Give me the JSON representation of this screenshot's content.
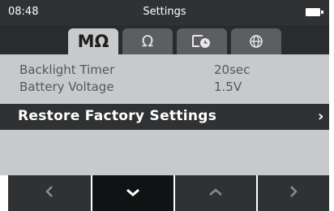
{
  "status": {
    "time": "08:48",
    "title": "Settings",
    "battery": "battery-icon"
  },
  "tabs": [
    {
      "label": "MΩ",
      "active": true
    },
    {
      "label": "Ω",
      "active": false
    },
    {
      "icon": "timer-icon",
      "active": false
    },
    {
      "icon": "globe-icon",
      "active": false
    }
  ],
  "settings": [
    {
      "label": "Backlight Timer",
      "value": "20sec"
    },
    {
      "label": "Battery Voltage",
      "value": "1.5V"
    }
  ],
  "highlighted": {
    "label": "Restore Factory Settings"
  },
  "colors": {
    "bar": "#2f3133",
    "panel": "#c8c9ca",
    "active_tab": "#c9cacb",
    "inactive_tab": "#5c5e61",
    "active_nav": "#111213"
  }
}
